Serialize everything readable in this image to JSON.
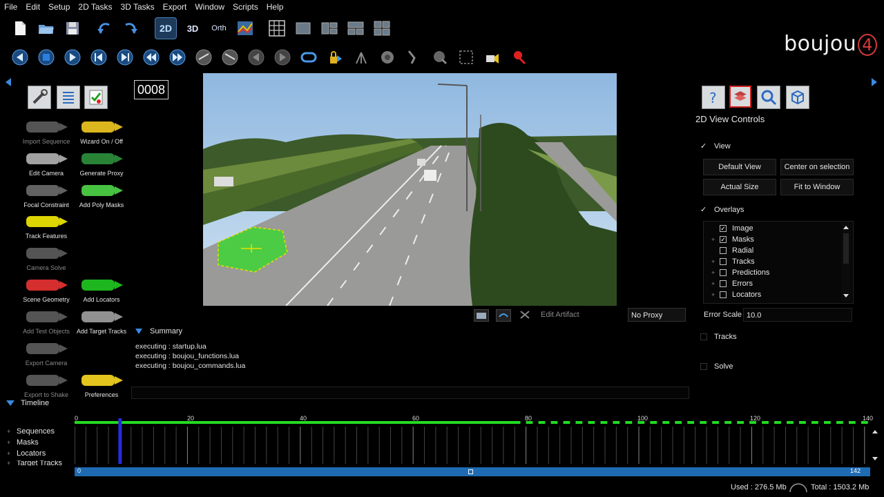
{
  "menu": [
    "File",
    "Edit",
    "Setup",
    "2D Tasks",
    "3D Tasks",
    "Export",
    "Window",
    "Scripts",
    "Help"
  ],
  "toolbar1": {
    "view_2d": "2D",
    "view_3d": "3D",
    "view_orth": "Orth"
  },
  "logo": {
    "text": "boujou",
    "suffix": "4"
  },
  "tools": [
    {
      "label": "Import Sequence",
      "dim": true
    },
    {
      "label": "Wizard On / Off",
      "dim": false
    },
    {
      "label": "Edit Camera",
      "dim": false
    },
    {
      "label": "Generate Proxy",
      "dim": false
    },
    {
      "label": "Focal Constraint",
      "dim": false
    },
    {
      "label": "Add Poly Masks",
      "dim": false
    },
    {
      "label": "Track Features",
      "dim": false
    },
    {
      "label": "Camera Solve",
      "dim": true
    },
    {
      "label": "Scene Geometry",
      "dim": false
    },
    {
      "label": "Add Locators",
      "dim": false
    },
    {
      "label": "Add Test Objects",
      "dim": true
    },
    {
      "label": "Add Target Tracks",
      "dim": false
    },
    {
      "label": "Export Camera",
      "dim": true
    },
    {
      "label": "Export to Shake",
      "dim": true
    },
    {
      "label": "Preferences",
      "dim": false
    }
  ],
  "viewer": {
    "frame_number": "0008",
    "edit_artifact": "Edit Artifact",
    "proxy": "No Proxy"
  },
  "summary": {
    "title": "Summary",
    "lines": [
      "executing : startup.lua",
      "executing : boujou_functions.lua",
      "executing : boujou_commands.lua"
    ]
  },
  "right_panel": {
    "title": "2D View Controls",
    "view_label": "View",
    "default_view": "Default View",
    "center_selection": "Center on selection",
    "actual_size": "Actual Size",
    "fit_window": "Fit to Window",
    "overlays_label": "Overlays",
    "overlays": [
      {
        "label": "Image",
        "checked": true,
        "expandable": false
      },
      {
        "label": "Masks",
        "checked": true,
        "expandable": true
      },
      {
        "label": "Radial",
        "checked": false,
        "expandable": false
      },
      {
        "label": "Tracks",
        "checked": false,
        "expandable": true
      },
      {
        "label": "Predictions",
        "checked": false,
        "expandable": true
      },
      {
        "label": "Errors",
        "checked": false,
        "expandable": true
      },
      {
        "label": "Locators",
        "checked": false,
        "expandable": true
      }
    ],
    "error_scale_label": "Error Scale",
    "error_scale_value": "10.0",
    "tracks_label": "Tracks",
    "solve_label": "Solve"
  },
  "timeline": {
    "title": "Timeline",
    "ruler": [
      "0",
      "20",
      "40",
      "60",
      "80",
      "100",
      "120",
      "140"
    ],
    "tracks": [
      "Sequences",
      "Masks",
      "Locators",
      "Target Tracks"
    ],
    "range_start": "0",
    "range_end": "142",
    "current_frame": 8
  },
  "status": {
    "used": "Used : 276.5 Mb",
    "total": "Total : 1503.2 Mb"
  },
  "colors": {
    "accent": "#1e6fb8",
    "green": "#22dd22",
    "mask": "#4ccc44",
    "highlight": "#1d3a5a"
  }
}
